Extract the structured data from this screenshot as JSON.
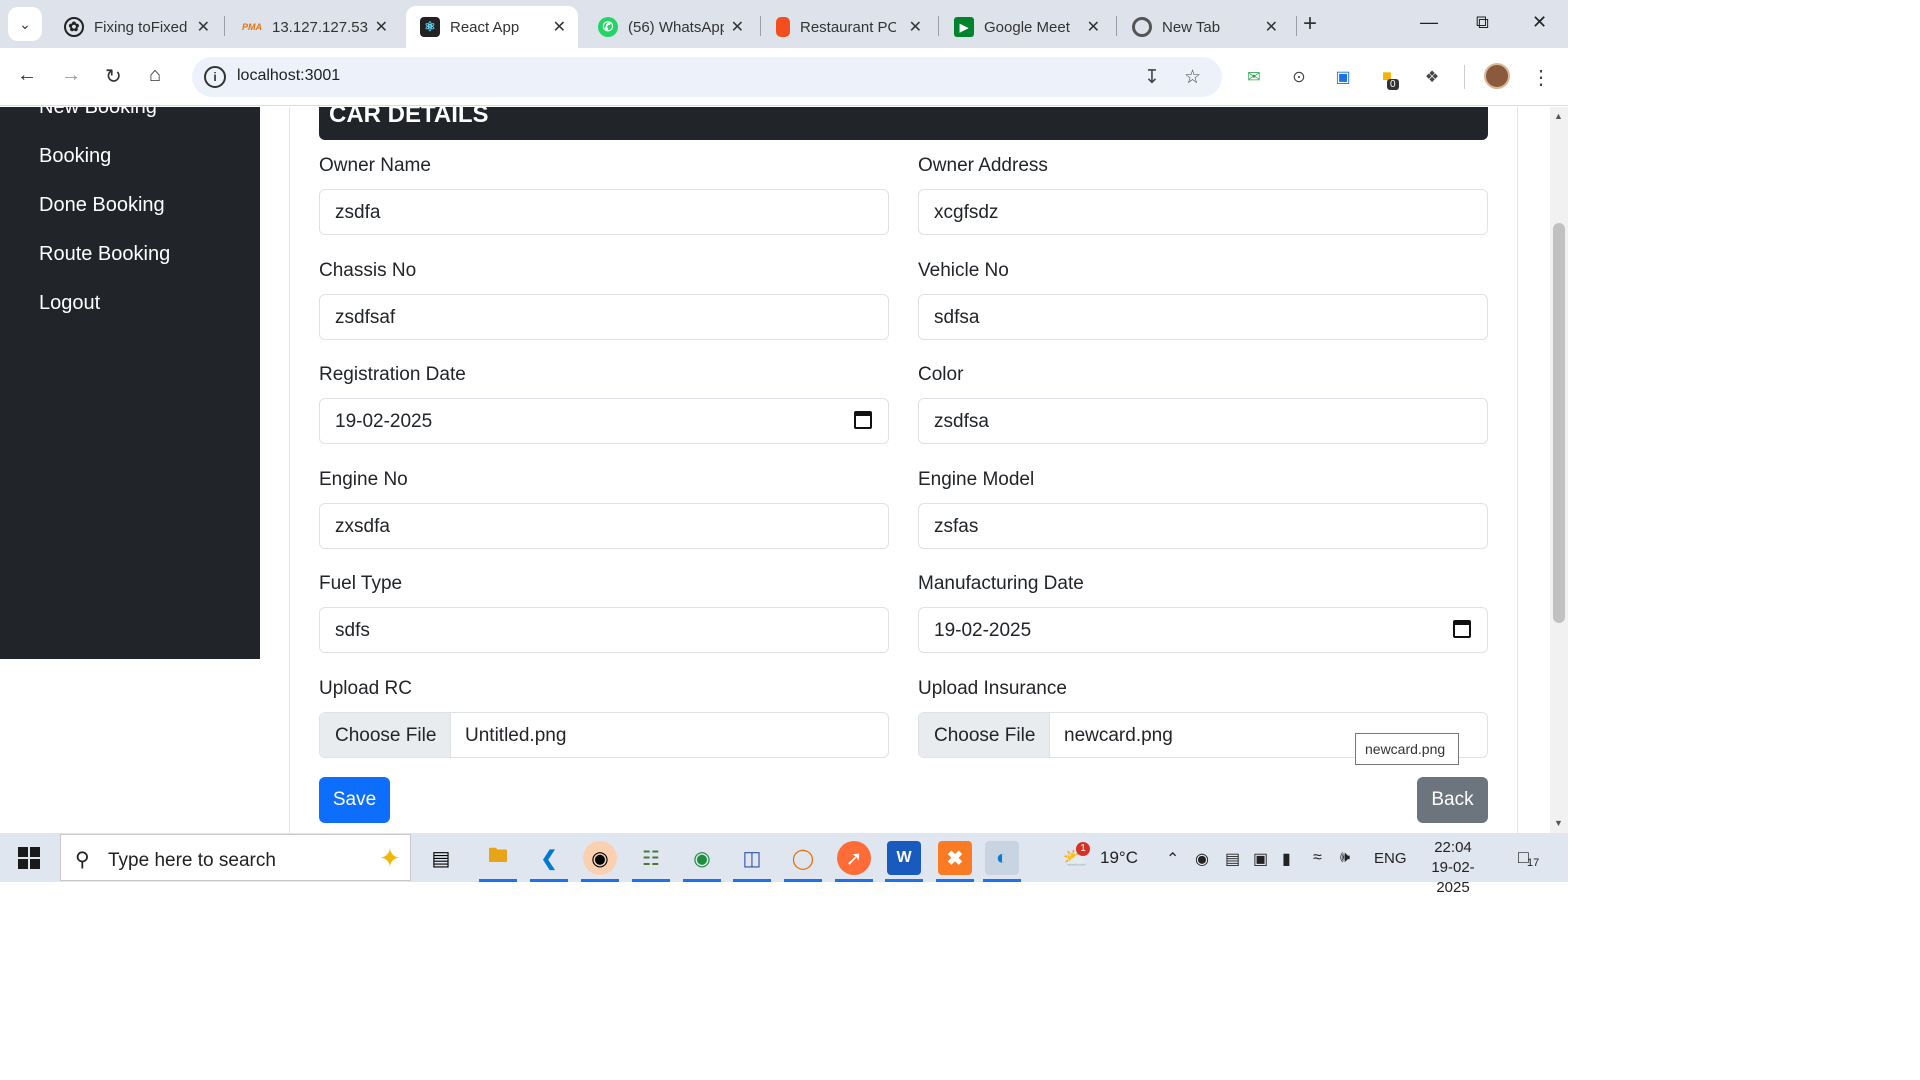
{
  "browser": {
    "tabs": [
      {
        "title": "Fixing toFixed",
        "icon": "openai-icon",
        "active": false
      },
      {
        "title": "13.127.127.53",
        "icon": "phpmyadmin-icon",
        "active": false
      },
      {
        "title": "React App",
        "icon": "react-icon",
        "active": true
      },
      {
        "title": "(56) WhatsApp",
        "icon": "whatsapp-icon",
        "active": false
      },
      {
        "title": "Restaurant PO",
        "icon": "figma-icon",
        "active": false
      },
      {
        "title": "Google Meet",
        "icon": "google-meet-icon",
        "active": false
      },
      {
        "title": "New Tab",
        "icon": "chrome-icon",
        "active": false
      }
    ],
    "url": "localhost:3001",
    "extension_badge": "0"
  },
  "sidebar": {
    "items": [
      "New Booking",
      "Booking",
      "Done Booking",
      "Route Booking",
      "Logout"
    ]
  },
  "form": {
    "header": "CAR DETAILS",
    "owner_name": {
      "label": "Owner Name",
      "value": "zsdfa"
    },
    "owner_address": {
      "label": "Owner Address",
      "value": "xcgfsdz"
    },
    "chassis_no": {
      "label": "Chassis No",
      "value": "zsdfsaf"
    },
    "vehicle_no": {
      "label": "Vehicle No",
      "value": "sdfsa"
    },
    "registration_date": {
      "label": "Registration Date",
      "value": "19-02-2025"
    },
    "color": {
      "label": "Color",
      "value": "zsdfsa"
    },
    "engine_no": {
      "label": "Engine No",
      "value": "zxsdfa"
    },
    "engine_model": {
      "label": "Engine Model",
      "value": "zsfas"
    },
    "fuel_type": {
      "label": "Fuel Type",
      "value": "sdfs"
    },
    "manufacturing_date": {
      "label": "Manufacturing Date",
      "value": "19-02-2025"
    },
    "upload_rc": {
      "label": "Upload RC",
      "button": "Choose File",
      "file": "Untitled.png"
    },
    "upload_insurance": {
      "label": "Upload Insurance",
      "button": "Choose File",
      "file": "newcard.png",
      "tooltip": "newcard.png"
    },
    "save_label": "Save",
    "back_label": "Back"
  },
  "taskbar": {
    "search_placeholder": "Type here to search",
    "weather": "19°C",
    "weather_badge": "1",
    "language": "ENG",
    "time": "22:04",
    "date": "19-02-2025",
    "notifications": "17"
  },
  "colors": {
    "sidebar_bg": "#212529",
    "primary": "#0d6efd",
    "secondary": "#6c757d"
  }
}
